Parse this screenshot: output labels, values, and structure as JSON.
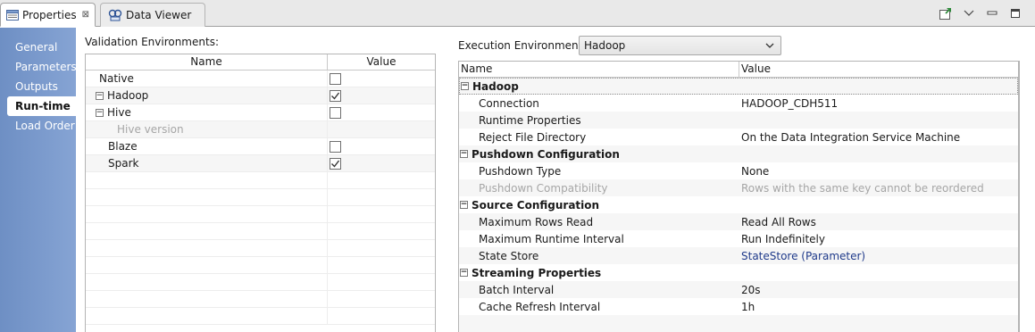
{
  "tabs": [
    {
      "label": "Properties",
      "icon": "properties-icon",
      "active": true
    },
    {
      "label": "Data Viewer",
      "icon": "data-viewer-icon",
      "active": false
    }
  ],
  "toolbar_icons": [
    "pin-icon",
    "view-menu-icon",
    "minimize-icon",
    "maximize-icon"
  ],
  "nav": {
    "items": [
      {
        "label": "General"
      },
      {
        "label": "Parameters"
      },
      {
        "label": "Outputs"
      },
      {
        "label": "Run-time",
        "selected": true
      },
      {
        "label": "Load Order"
      }
    ]
  },
  "validation": {
    "label": "Validation Environments:",
    "columns": [
      "Name",
      "Value"
    ],
    "rows": [
      {
        "name": "Native",
        "checked": false
      },
      {
        "name": "Hadoop",
        "checked": true,
        "expandable": true
      },
      {
        "name": "Hive",
        "checked": false,
        "expandable": true
      },
      {
        "name": "Hive version",
        "disabled": true
      },
      {
        "name": "Blaze",
        "checked": false
      },
      {
        "name": "Spark",
        "checked": true
      }
    ]
  },
  "execution": {
    "label": "Execution Environment:",
    "value": "Hadoop"
  },
  "properties": {
    "columns": [
      "Name",
      "Value"
    ],
    "groups": [
      {
        "title": "Hadoop",
        "rows": [
          {
            "name": "Connection",
            "value": "HADOOP_CDH511"
          },
          {
            "name": "Runtime Properties",
            "value": ""
          },
          {
            "name": "Reject File Directory",
            "value": "On the Data Integration Service Machine"
          }
        ]
      },
      {
        "title": "Pushdown Configuration",
        "rows": [
          {
            "name": "Pushdown Type",
            "value": "None"
          },
          {
            "name": "Pushdown Compatibility",
            "value": "Rows with the same key cannot be reordered",
            "disabled": true
          }
        ]
      },
      {
        "title": "Source Configuration",
        "rows": [
          {
            "name": "Maximum Rows Read",
            "value": "Read All Rows"
          },
          {
            "name": "Maximum Runtime Interval",
            "value": "Run Indefinitely"
          },
          {
            "name": "State Store",
            "value": "StateStore (Parameter)",
            "link": true
          }
        ]
      },
      {
        "title": "Streaming Properties",
        "rows": [
          {
            "name": "Batch Interval",
            "value": "20s"
          },
          {
            "name": "Cache Refresh Interval",
            "value": "1h"
          }
        ]
      }
    ]
  },
  "colors": {
    "nav_gradient_start": "#6e8fc4",
    "nav_gradient_end": "#86a4d4",
    "link": "#1f3a8a",
    "disabled_text": "#a6a6a6"
  }
}
